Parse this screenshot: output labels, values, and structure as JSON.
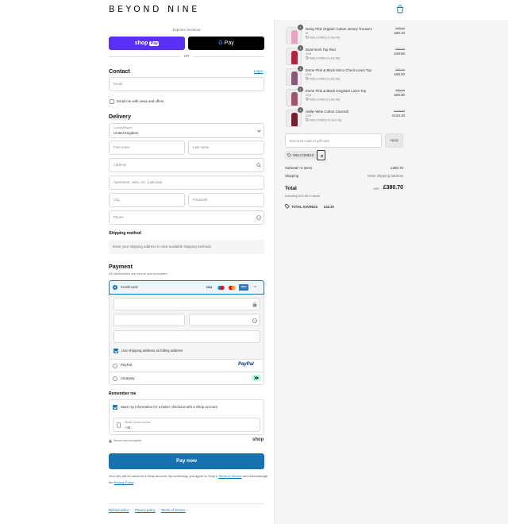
{
  "brand": {
    "logo": "BEYOND NINE",
    "accent": "#1773b0"
  },
  "header": {
    "cart_icon": "shopping-bag-icon"
  },
  "express": {
    "title": "Express checkout",
    "shop_pay_label": "shop",
    "shop_pay_badge": "Pay",
    "gpay_label": "Pay",
    "gpay_g": "G",
    "or": "OR"
  },
  "contact": {
    "title": "Contact",
    "login": "Log in",
    "email_placeholder": "Email",
    "newsletter": "Email me with news and offers"
  },
  "delivery": {
    "title": "Delivery",
    "country_label": "Country/Region",
    "country_value": "United Kingdom",
    "first_name": "First name",
    "last_name": "Last name",
    "address": "Address",
    "apartment": "Apartment, suite, etc. (optional)",
    "city": "City",
    "postcode": "Postcode",
    "phone": "Phone"
  },
  "shipping_method": {
    "title": "Shipping method",
    "note": "Enter your shipping address to view available shipping methods."
  },
  "payment": {
    "title": "Payment",
    "subtitle": "All transactions are secure and encrypted.",
    "credit_card": "Credit card",
    "card_more": "+4",
    "visa": "VISA",
    "amex": "AMEX",
    "billing_same": "Use shipping address as billing address",
    "paypal": "PayPal",
    "paypal_logo": "PayPal",
    "clearpay": "Clearpay"
  },
  "remember": {
    "title": "Remember me",
    "save_info": "Save my information for a faster checkout with a Shop account",
    "mobile_label": "Mobile phone number",
    "mobile_value": "+44",
    "secure": "Secure and encrypted",
    "shop_logo": "shop"
  },
  "pay_now": "Pay now",
  "legal": {
    "prefix": "Your info will be saved to a Shop account. By continuing, you agree to Shop's ",
    "terms": "Terms of Service",
    "middle": " and acknowledge the ",
    "privacy": "Privacy Policy",
    "suffix": "."
  },
  "footer": {
    "links": [
      "Refund policy",
      "Privacy policy",
      "Terms of service"
    ]
  },
  "cart": {
    "items": [
      {
        "qty": "1",
        "name": "Daisy Pink Organic Cotton Jersey Trousers",
        "variant": "M",
        "discount": "WELCOME10 (-£8.90)",
        "old_price": "£89.00",
        "price": "£80.10",
        "color": "#e7a3c2"
      },
      {
        "qty": "1",
        "name": "Boat Neck Top Red",
        "variant": "2XS",
        "discount": "WELCOME10 (-£5.50)",
        "old_price": "£55.00",
        "price": "£49.50",
        "color": "#b3213a"
      },
      {
        "qty": "1",
        "name": "Esme Pink & Black Micro Check Linen Top",
        "variant": "2XS",
        "discount": "WELCOME10 (-£6.50)",
        "old_price": "£65.00",
        "price": "£58.50",
        "color": "#8a5a7a"
      },
      {
        "qty": "1",
        "name": "Esme Pink & Black Gingham Linen Top",
        "variant": "2XS",
        "discount": "WELCOME10 (-£6.50)",
        "old_price": "£65.00",
        "price": "£58.50",
        "color": "#a3526b"
      },
      {
        "qty": "1",
        "name": "Hallie Wine Cotton Coverall",
        "variant": "2XS",
        "discount": "WELCOME10 (-£14.90)",
        "old_price": "£149.00",
        "price": "£134.10",
        "color": "#7a1e2e"
      }
    ],
    "discount_placeholder": "Discount code or gift card",
    "apply": "Apply",
    "applied_code": "WELCOME10",
    "subtotal_label": "Subtotal • 5 items",
    "subtotal_value": "£380.70",
    "shipping_label": "Shipping",
    "shipping_value": "Enter shipping address",
    "total_label": "Total",
    "total_currency": "GBP",
    "total_value": "£380.70",
    "taxes": "Including £63.45 in taxes",
    "savings_label": "TOTAL SAVINGS",
    "savings_value": "£42.30"
  }
}
